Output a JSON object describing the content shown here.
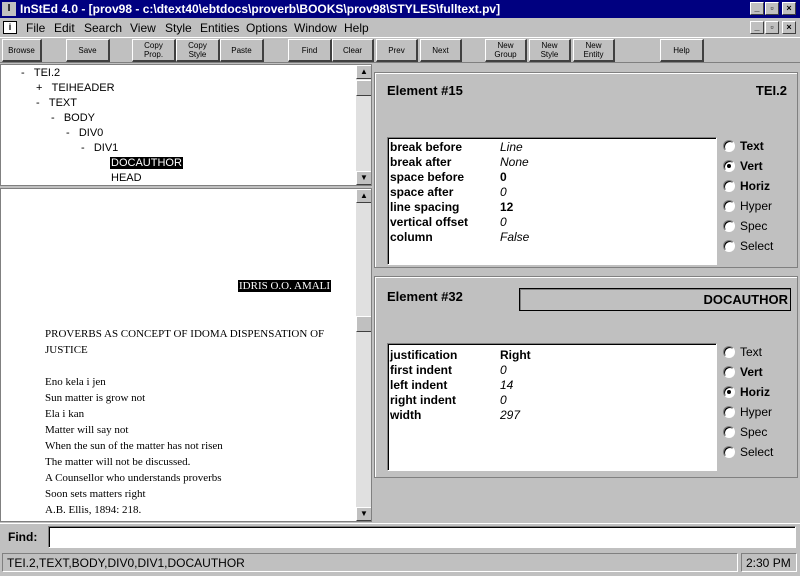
{
  "window": {
    "title": "InStEd 4.0 - [prov98 - c:\\dtext40\\ebtdocs\\proverb\\BOOKS\\prov98\\STYLES\\fulltext.pv]",
    "min_glyph": "_",
    "max_glyph": "▫",
    "close_glyph": "×"
  },
  "menu": [
    "File",
    "Edit",
    "Search",
    "View",
    "Style",
    "Entities",
    "Options",
    "Window",
    "Help"
  ],
  "toolbar": {
    "browse": "Browse",
    "save": "Save",
    "copy_prop_1": "Copy",
    "copy_prop_2": "Prop.",
    "copy_style_1": "Copy",
    "copy_style_2": "Style",
    "paste": "Paste",
    "find": "Find",
    "clear": "Clear",
    "prev": "Prev",
    "next": "Next",
    "new_group_1": "New",
    "new_group_2": "Group",
    "new_style_1": "New",
    "new_style_2": "Style",
    "new_entity_1": "New",
    "new_entity_2": "Entity",
    "help": "Help"
  },
  "tree": [
    {
      "marker": "-",
      "label": "TEI.2"
    },
    {
      "marker": "+",
      "label": "TEIHEADER"
    },
    {
      "marker": "-",
      "label": "TEXT"
    },
    {
      "marker": "-",
      "label": "BODY"
    },
    {
      "marker": "-",
      "label": "DIV0"
    },
    {
      "marker": "-",
      "label": "DIV1"
    },
    {
      "marker": "",
      "label": "DOCAUTHOR",
      "selected": true
    },
    {
      "marker": "",
      "label": "HEAD"
    }
  ],
  "document": {
    "docauthor": "IDRIS O.O. AMALI",
    "lines": [
      "PROVERBS AS CONCEPT OF IDOMA DISPENSATION OF",
      "JUSTICE",
      "Eno kela i jen",
      "Sun matter is grow not",
      "Ela i kan",
      "Matter will say not",
      "When the sun of the matter has not risen",
      "The matter will not be discussed.",
      "A Counsellor who understands proverbs",
      "Soon sets matters right",
      "A.B. Ellis, 1894: 218."
    ]
  },
  "element15": {
    "title": "Element #15",
    "tag": "TEI.2",
    "props": [
      {
        "name": "break before",
        "value": "Line",
        "style": "italic"
      },
      {
        "name": "break after",
        "value": "None",
        "style": "italic"
      },
      {
        "name": "space before",
        "value": "0",
        "style": "bold"
      },
      {
        "name": "space after",
        "value": "0",
        "style": "italic"
      },
      {
        "name": "line spacing",
        "value": "12",
        "style": "bold"
      },
      {
        "name": "vertical offset",
        "value": "0",
        "style": "italic"
      },
      {
        "name": "column",
        "value": "False",
        "style": "italic"
      }
    ],
    "radios": [
      {
        "label": "Text",
        "bold": true,
        "checked": false
      },
      {
        "label": "Vert",
        "bold": true,
        "checked": true
      },
      {
        "label": "Horiz",
        "bold": true,
        "checked": false
      },
      {
        "label": "Hyper",
        "bold": false,
        "checked": false
      },
      {
        "label": "Spec",
        "bold": false,
        "checked": false
      },
      {
        "label": "Select",
        "bold": false,
        "checked": false
      }
    ]
  },
  "element32": {
    "title": "Element #32",
    "tag": "DOCAUTHOR",
    "props": [
      {
        "name": "justification",
        "value": "Right",
        "style": "bold"
      },
      {
        "name": "first indent",
        "value": "0",
        "style": "italic"
      },
      {
        "name": "left indent",
        "value": "14",
        "style": "italic"
      },
      {
        "name": "right indent",
        "value": "0",
        "style": "italic"
      },
      {
        "name": "width",
        "value": "297",
        "style": "italic"
      }
    ],
    "radios": [
      {
        "label": "Text",
        "bold": false,
        "checked": false
      },
      {
        "label": "Vert",
        "bold": true,
        "checked": false
      },
      {
        "label": "Horiz",
        "bold": true,
        "checked": true
      },
      {
        "label": "Hyper",
        "bold": false,
        "checked": false
      },
      {
        "label": "Spec",
        "bold": false,
        "checked": false
      },
      {
        "label": "Select",
        "bold": false,
        "checked": false
      }
    ]
  },
  "find": {
    "label": "Find:",
    "value": ""
  },
  "status": {
    "path": "TEI.2,TEXT,BODY,DIV0,DIV1,DOCAUTHOR",
    "time": "2:30 PM"
  }
}
